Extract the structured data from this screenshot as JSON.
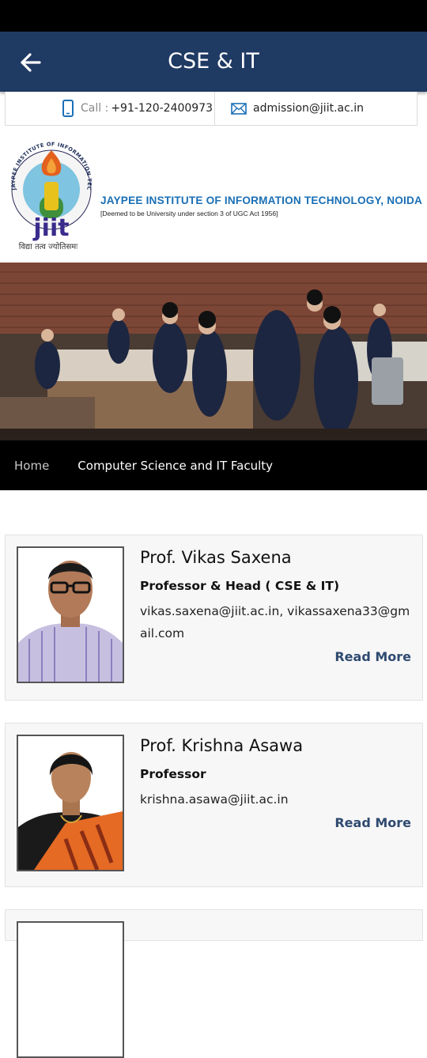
{
  "header": {
    "title": "CSE & IT"
  },
  "contact": {
    "call_label": "Call :",
    "call_number": "+91-120-2400973",
    "email": "admission@jiit.ac.in"
  },
  "institute": {
    "name": "JAYPEE INSTITUTE OF INFORMATION TECHNOLOGY, NOIDA",
    "subtitle": "[Deemed to be University under section 3 of UGC Act 1956]",
    "logo_text": "jiit",
    "logo_ring_text": "JAYPEE INSTITUTE OF INFORMATION TECHNOLOGY",
    "motto": "विद्या तत्व ज्योतिसमः"
  },
  "breadcrumb": {
    "home": "Home",
    "current": "Computer Science and IT Faculty"
  },
  "faculty": [
    {
      "name": "Prof. Vikas Saxena",
      "role": "Professor & Head ( CSE & IT)",
      "email": "vikas.saxena@jiit.ac.in, vikassaxena33@gmail.com",
      "read_more": "Read More"
    },
    {
      "name": "Prof. Krishna Asawa",
      "role": "Professor",
      "email": "krishna.asawa@jiit.ac.in",
      "read_more": "Read More"
    }
  ],
  "colors": {
    "app_bar": "#1f3a63",
    "institute_blue": "#1a6fb5",
    "read_more": "#2f4a70"
  },
  "icons": {
    "back": "arrow-left-icon",
    "phone": "phone-icon",
    "mail": "mail-icon"
  }
}
